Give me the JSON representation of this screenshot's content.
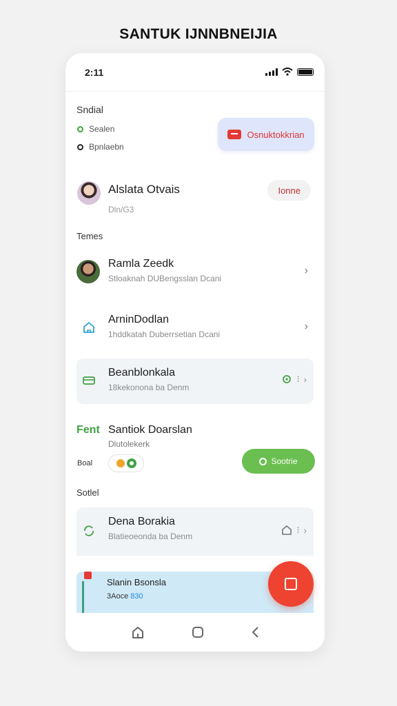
{
  "page_title": "SANTUK IJNNBNEIJIA",
  "status": {
    "time": "2:11"
  },
  "header": {
    "section_label": "Sndial",
    "row1": "Sealen",
    "row2": "Bpnlaebn",
    "promo_button": "Osnuktokkrian"
  },
  "profile": {
    "name": "Alslata Otvais",
    "subtitle": "Dln/G3",
    "pill": "Ionne"
  },
  "section2_label": "Temes",
  "items": [
    {
      "title": "Ramla Zeedk",
      "subtitle": "Stloaknah DUBengsslan Dcani"
    },
    {
      "title": "ArninDodlan",
      "subtitle": "1hddkatah Duberrsetian Dcani"
    },
    {
      "title": "Beanblonkala",
      "subtitle": "18kekonona ba Denm"
    }
  ],
  "feature": {
    "tag": "Fent",
    "title": "Santiok Doarslan",
    "subtitle": "Dlutolekerk",
    "label": "Boal",
    "button": "Sootrie"
  },
  "section3_label": "Sotlel",
  "item4": {
    "title": "Dena Borakia",
    "subtitle": "Blatieoeonda ba Denm"
  },
  "banner": {
    "title": "Slanin Bsonsla",
    "sub_prefix": "3Aoce",
    "sub_highlight": "830"
  },
  "colors": {
    "accent_red": "#ee4330",
    "accent_green": "#6abf50",
    "promo_bg": "#dfe6fb",
    "banner_bg": "#cfe9f7"
  }
}
